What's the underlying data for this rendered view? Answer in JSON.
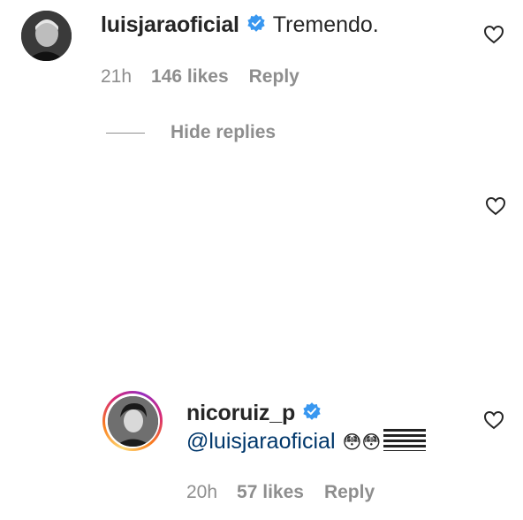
{
  "comment1": {
    "username": "luisjaraoficial",
    "text": "Tremendo.",
    "time": "21h",
    "likes": "146 likes",
    "reply": "Reply"
  },
  "thread": {
    "hide_replies": "Hide replies"
  },
  "comment2": {
    "username": "nicoruiz_p",
    "mention": "@luisjaraoficial",
    "emoji": "😳😳",
    "time": "20h",
    "likes": "57 likes",
    "reply": "Reply"
  },
  "colors": {
    "verified": "#3897f0",
    "mention": "#00376b",
    "meta": "#8e8e8e"
  },
  "icons": [
    "heart-icon",
    "verified-badge-icon",
    "chinese-flag-emoji"
  ]
}
